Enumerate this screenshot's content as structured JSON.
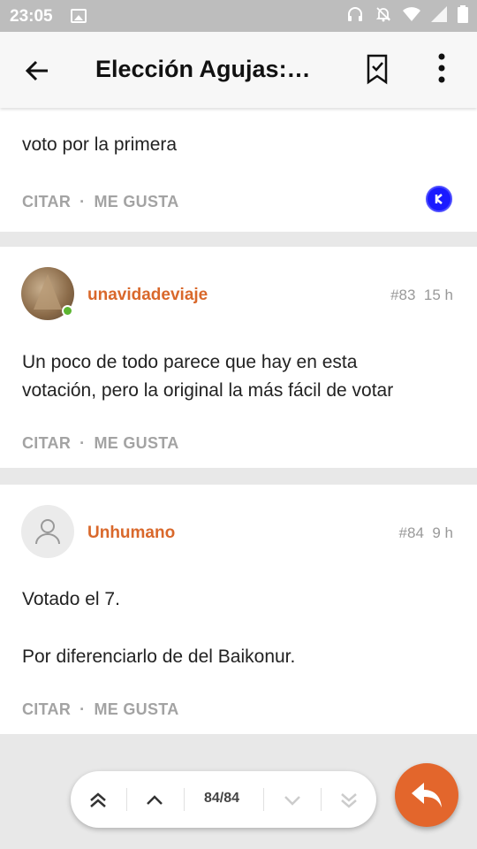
{
  "status_bar": {
    "time": "23:05"
  },
  "app_bar": {
    "title": "Elección Agujas:…"
  },
  "posts": [
    {
      "body": [
        "voto por la primera"
      ],
      "actions": {
        "quote": "CITAR",
        "like": "ME GUSTA"
      }
    },
    {
      "username": "unavidadeviaje",
      "number": "#83",
      "time": "15 h",
      "online": true,
      "body": [
        "Un poco de todo parece que hay en esta",
        "votación, pero la original la más fácil de votar"
      ],
      "actions": {
        "quote": "CITAR",
        "like": "ME GUSTA"
      }
    },
    {
      "username": "Unhumano",
      "number": "#84",
      "time": "9 h",
      "body": [
        "Votado el 7.",
        "Por diferenciarlo de del Baikonur."
      ],
      "actions": {
        "quote": "CITAR",
        "like": "ME GUSTA"
      }
    }
  ],
  "pager": {
    "position": "84/84"
  },
  "icons": {
    "back": "arrow-left-icon",
    "bookmark": "bookmark-check-icon",
    "more": "more-vertical-icon",
    "first": "double-chevron-up-icon",
    "prev": "chevron-up-icon",
    "next": "chevron-down-icon",
    "last": "double-chevron-down-icon",
    "reply": "reply-icon"
  },
  "colors": {
    "accent": "#e3662c",
    "username": "#d9682b",
    "online": "#5cb531",
    "badge": "#1a1aff"
  }
}
